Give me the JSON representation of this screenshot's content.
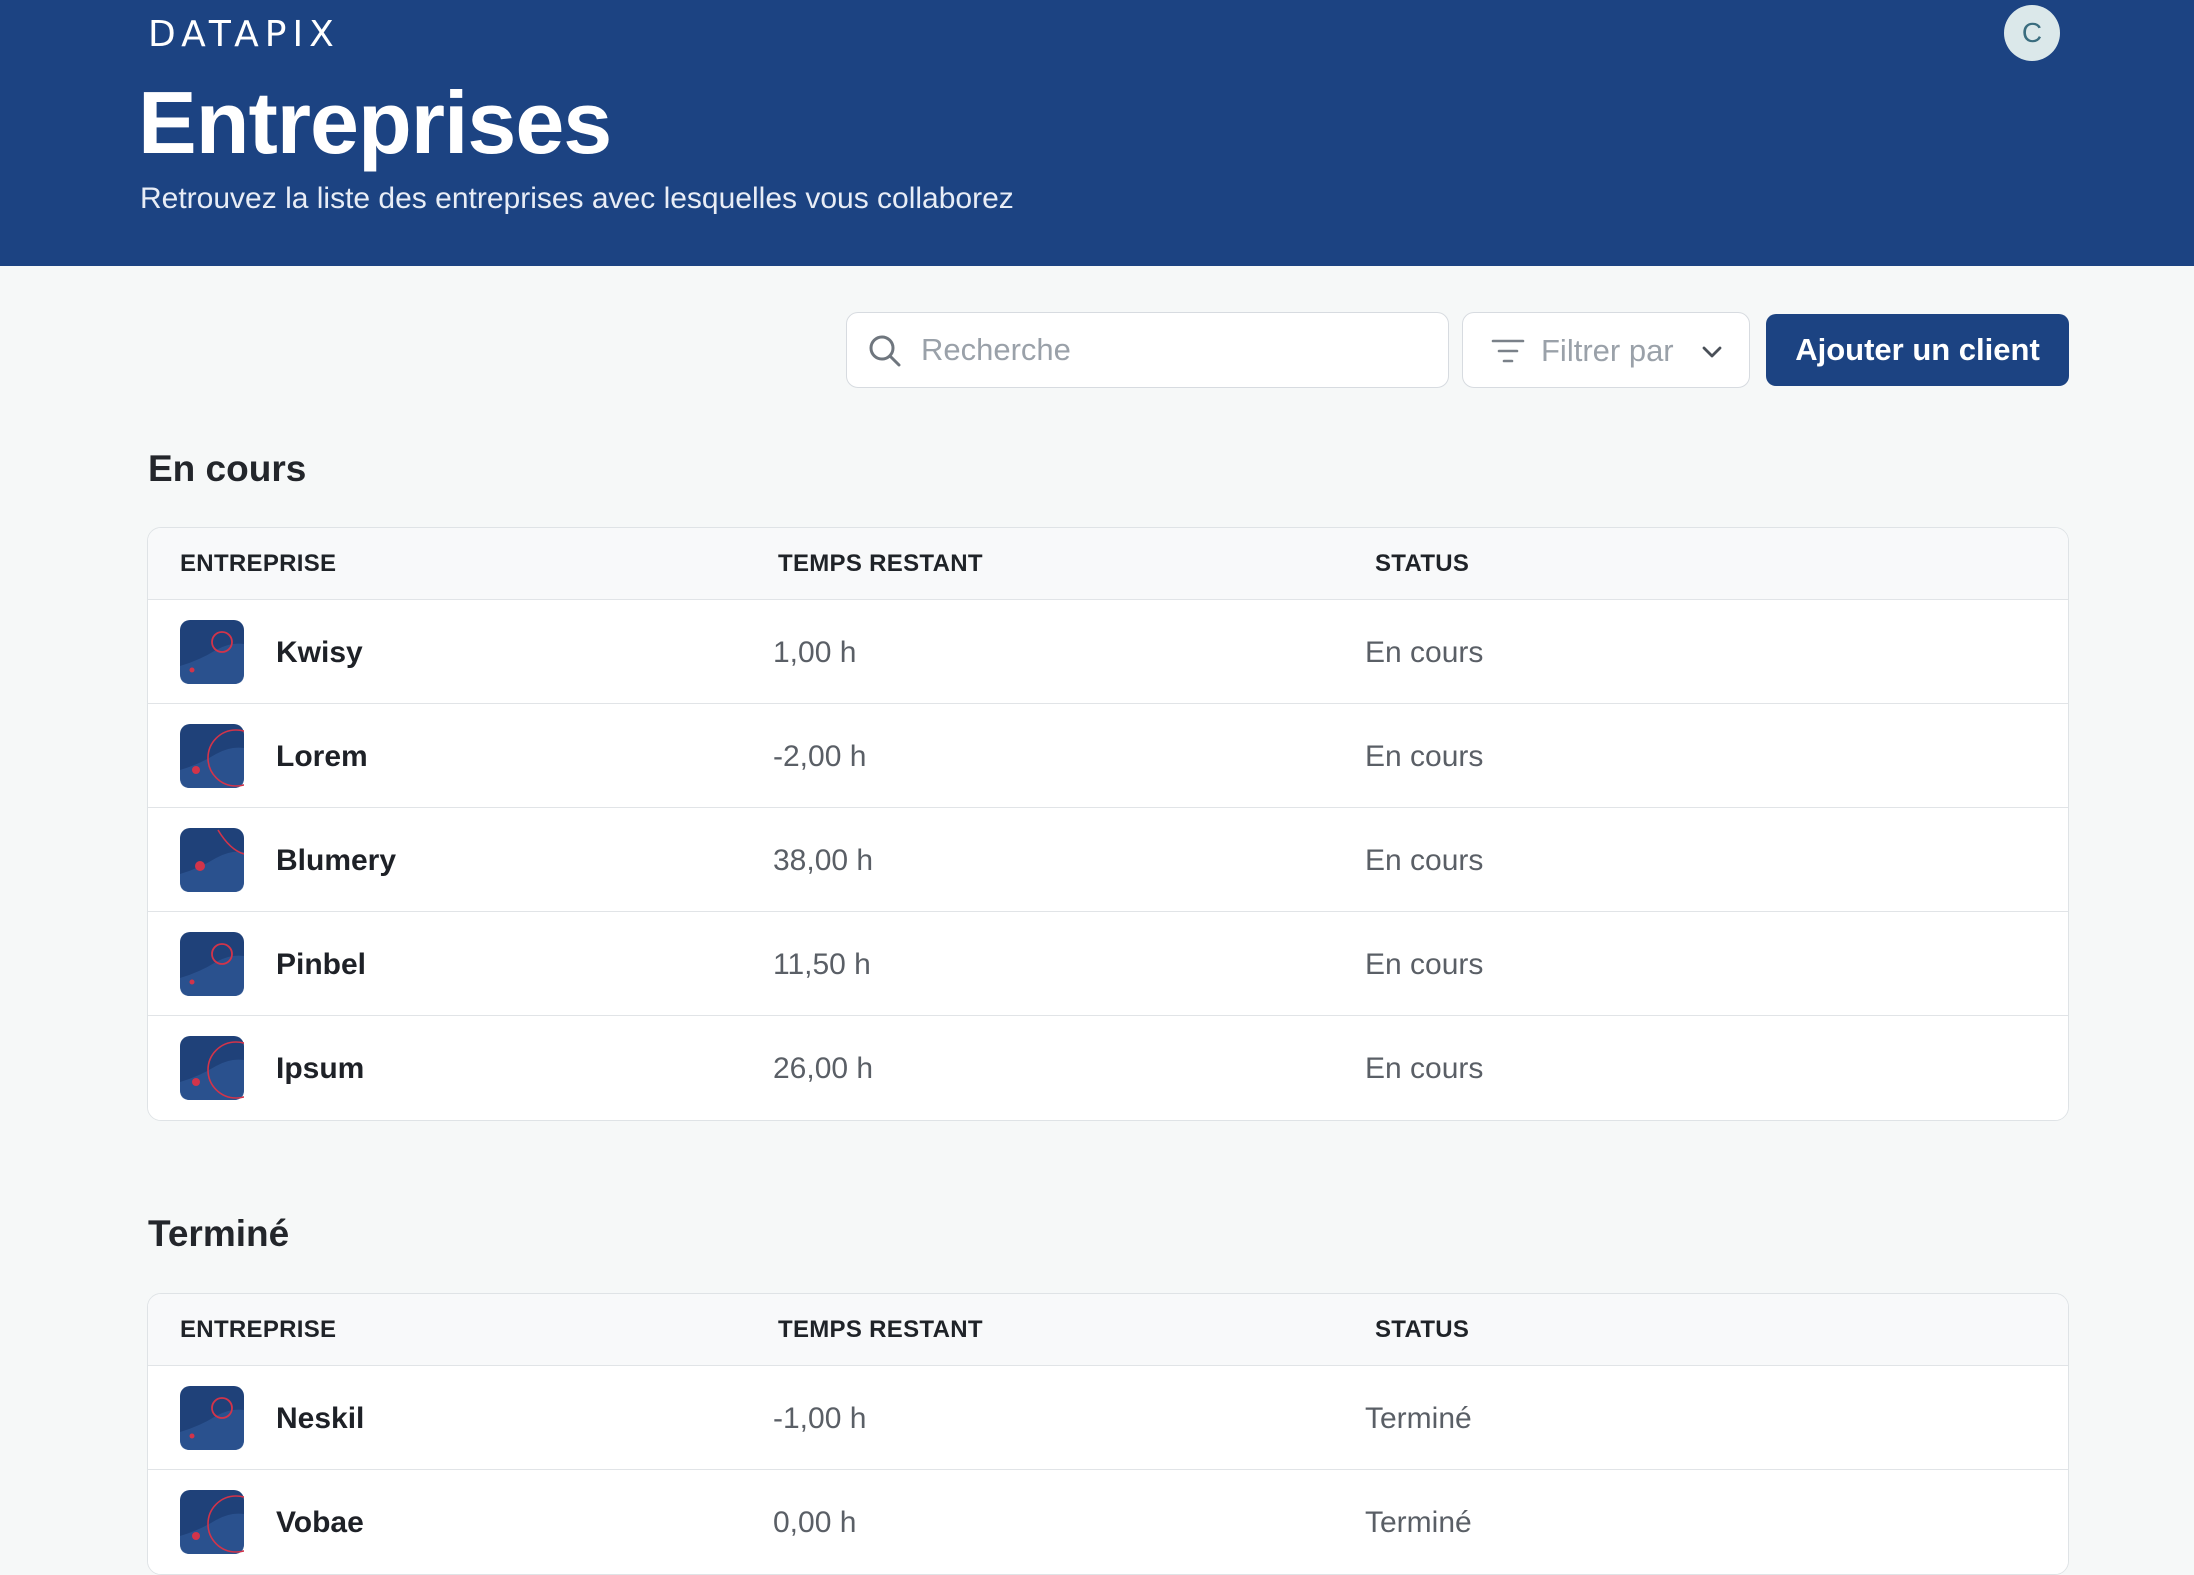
{
  "header": {
    "logo": "DATAPIX",
    "avatar_initial": "C",
    "title": "Entreprises",
    "subtitle": "Retrouvez la liste des entreprises avec lesquelles vous collaborez",
    "background_color": "#1c4382"
  },
  "toolbar": {
    "search_placeholder": "Recherche",
    "search_icon": "search-icon",
    "filter_label": "Filtrer par",
    "filter_icon": "filter-icon",
    "filter_chevron_icon": "chevron-down-icon",
    "add_button_label": "Ajouter un client"
  },
  "columns": {
    "company": "ENTREPRISE",
    "remaining": "TEMPS RESTANT",
    "status": "STATUS"
  },
  "sections": {
    "in_progress": {
      "title": "En cours",
      "rows": [
        {
          "name": "Kwisy",
          "remaining": "1,00 h",
          "status": "En cours"
        },
        {
          "name": "Lorem",
          "remaining": "-2,00 h",
          "status": "En cours"
        },
        {
          "name": "Blumery",
          "remaining": "38,00 h",
          "status": "En cours"
        },
        {
          "name": "Pinbel",
          "remaining": "11,50 h",
          "status": "En cours"
        },
        {
          "name": "Ipsum",
          "remaining": "26,00 h",
          "status": "En cours"
        }
      ]
    },
    "done": {
      "title": "Terminé",
      "rows": [
        {
          "name": "Neskil",
          "remaining": "-1,00 h",
          "status": "Terminé"
        },
        {
          "name": "Vobae",
          "remaining": "0,00 h",
          "status": "Terminé"
        }
      ]
    }
  },
  "colors": {
    "primary": "#1c4382",
    "page_background": "#f6f8f8",
    "logo_tile_accent": "#d2344a"
  }
}
